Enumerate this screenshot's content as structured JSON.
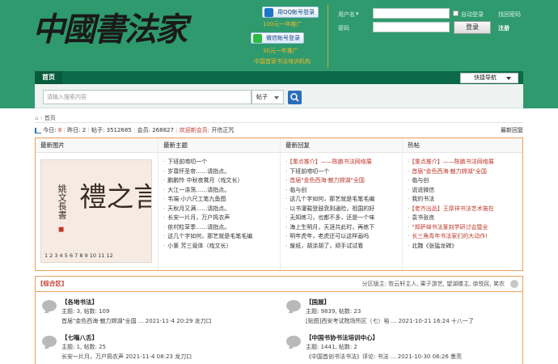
{
  "header": {
    "logo_text": "中國書法家",
    "qq_login": "用QQ帐号登录",
    "qq_promo": "100元一年推广",
    "wechat_login": "微信帐号登录",
    "wechat_promo": "30元一年推广",
    "wechat_promo2": "中国首家书法培训机构",
    "username_label": "用户名",
    "password_label": "密码",
    "auto_login": "自动登录",
    "forgot_password": "找回密码",
    "login_button": "登录",
    "register": "注册"
  },
  "nav": {
    "home": "首页",
    "quick_nav": "快捷导航"
  },
  "search": {
    "placeholder": "请输入搜索内容",
    "type": "帖子"
  },
  "breadcrumb": "首页",
  "stats": {
    "today_label": "今日:",
    "today": "8",
    "yesterday_label": "昨日:",
    "yesterday": "2",
    "posts_label": "帖子:",
    "posts": "3512685",
    "members_label": "会员:",
    "members": "268827",
    "welcome_label": "欢迎新会员:",
    "new_member": "开信正咒",
    "latest_reply": "最新回复"
  },
  "columns": {
    "images_title": "最新图片",
    "topics_title": "最新主题",
    "topics": [
      "下班前唠叨一个",
      "岁尊怀圣帝……请指点。",
      "鹏鹏怜 中秋夜賞月（戏文长）",
      "大江一涤荡……请指点。",
      "韦端·小六尺工笔九鱼图",
      "天秋月又满……请指点。",
      "长安一片月，万户捣衣声",
      "依村粒草季……请指点。",
      "这几个字如何，那艺就是毛笔毛编",
      "小篆 芳三竟体（戏文长）"
    ],
    "replies_title": "最新回复",
    "replies": [
      {
        "text": "【重点推介】——陈鹏书法网络展",
        "red": true
      },
      {
        "text": "下班前唠叨一个",
        "red": false
      },
      {
        "text": "首届\"金色西海·魅力嫦湖\"全国",
        "red": true
      },
      {
        "text": "临与创",
        "red": false
      },
      {
        "text": "这几个字如何，那艺就是毛笔毛编",
        "red": false
      },
      {
        "text": "以书灌载登鼓衰则通险，祖国的好",
        "red": false
      },
      {
        "text": "无知练习，也都不多，还是一个味",
        "red": false
      },
      {
        "text": "海上生明月，天涯共此时，再练下",
        "red": false
      },
      {
        "text": "明年虎年，老虎还可以这样画吗",
        "red": false
      },
      {
        "text": "废纸，胡涂胡了，顽手试试看",
        "red": false
      }
    ],
    "hot_title": "热帖",
    "hot": [
      {
        "text": "【重点推介】——陈鹏书法网络展",
        "red": true
      },
      {
        "text": "首届\"金色西海·魅力嫦湖\"全国",
        "red": true
      },
      {
        "text": "临与创",
        "red": false
      },
      {
        "text": "说说微信",
        "red": false
      },
      {
        "text": "我的书法",
        "red": false
      },
      {
        "text": "【老齐出品】王厚祥书法艺术笛在",
        "red": true
      },
      {
        "text": "袁书张良",
        "red": false
      },
      {
        "text": "\"郑萨禅书法篆刻学研讨会暨全",
        "red": true
      },
      {
        "text": "长三角青年书法家们的大动作!",
        "red": true
      },
      {
        "text": "北魏《张猛龙碑》",
        "red": false
      }
    ]
  },
  "image_seal": {
    "main_chars": "禮之言",
    "side_chars": "姚文長書",
    "numbers": "1 2 3 4 5 6 7 8 9 10 11 12"
  },
  "section": {
    "title": "[综合区]",
    "moderators": "分区版主: 牧云轩主人, 果子游艺, 望湖楼主, 徐悦民, 笑农",
    "forums": [
      {
        "name": "【各地书法】",
        "stats": "主题: 3, 帖数: 109",
        "last": "首届\"金色西海·魅力嫦湖\"全国 ... 2021-11-4 20:29 龙刀口"
      },
      {
        "name": "【国展】",
        "stats": "主题: 9839, 帖数: 23",
        "last": "[贴图]西安考试院场所区（七）裕 ... 2021-10-21 16:24 十八一了"
      },
      {
        "name": "【七嗡八舌】",
        "stats": "主题: 1, 帖数: 25",
        "last": "长安一片月，万户捣衣声 2021-11-4 08:23 龙刀口"
      },
      {
        "name": "【中国书协书法培训中心】",
        "stats": "主题: 1441, 帖数: 2",
        "last": "《中国首创书法书法》评论: 书法 ... 2021-10-30 06:26 墨亮"
      }
    ]
  },
  "colors": {
    "header_bg": "#2e9a6e",
    "nav_bg": "#0c6a4a",
    "accent_red": "#c0392b",
    "border_orange": "#e8a05a"
  }
}
